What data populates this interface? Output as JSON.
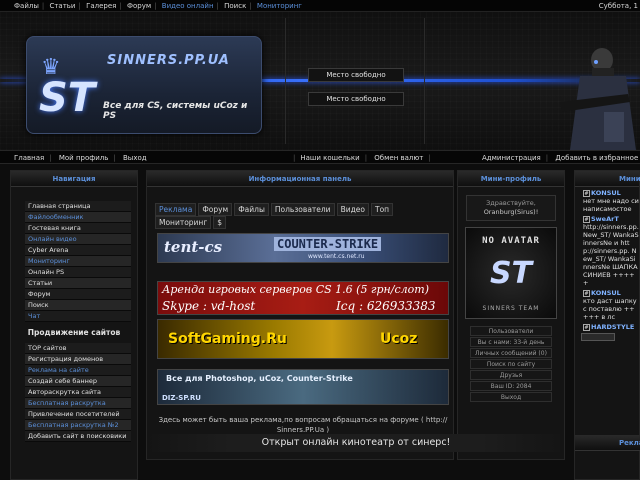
{
  "topnav": {
    "items": [
      "Файлы",
      "Статьи",
      "Галерея",
      "Форум",
      "Видео онлайн",
      "Поиск",
      "Мониторинг"
    ],
    "date": "Суббота, 1"
  },
  "header": {
    "site_name": "SINNERS.PP.UA",
    "logo_mark": "ST",
    "tagline": "Все для CS, системы uCoz и PS",
    "place1": "Место свободно",
    "place2": "Место свободно"
  },
  "subnav": {
    "left": [
      "Главная",
      "Мой профиль",
      "Выход"
    ],
    "middle": [
      "Наши кошельки",
      "Обмен валют"
    ],
    "right": [
      "Администрация",
      "Добавить в избранное"
    ]
  },
  "left": {
    "nav_title": "Навигация",
    "items": [
      {
        "label": "Главная страница",
        "blue": false
      },
      {
        "label": "Файлообменник",
        "blue": true
      },
      {
        "label": "Гостевая книга",
        "blue": false
      },
      {
        "label": "Онлайн видео",
        "blue": true
      },
      {
        "label": "Cyber Arena",
        "blue": false
      },
      {
        "label": "Мониторинг",
        "blue": true
      },
      {
        "label": "Онлайн PS",
        "blue": false
      },
      {
        "label": "Статьи",
        "blue": false
      },
      {
        "label": "Форум",
        "blue": false
      },
      {
        "label": "Поиск",
        "blue": false
      },
      {
        "label": "Чат",
        "blue": true
      }
    ],
    "promo_title": "Продвижение сайтов",
    "promo_items": [
      {
        "label": "TOP сайтов",
        "blue": false
      },
      {
        "label": "Регистрация доменов",
        "blue": false
      },
      {
        "label": "Реклама на сайте",
        "blue": true
      },
      {
        "label": "Создай себе баннер",
        "blue": false
      },
      {
        "label": "Автораскрутка сайта",
        "blue": false
      },
      {
        "label": "Бесплатная раскрутка",
        "blue": true
      },
      {
        "label": "Привлечение посетителей",
        "blue": false
      },
      {
        "label": "Бесплатная раскрутка №2",
        "blue": true
      },
      {
        "label": "Добавить сайт в поисковики",
        "blue": false
      }
    ]
  },
  "center": {
    "title": "Информационная панель",
    "tabs": [
      "Реклама",
      "Форум",
      "Файлы",
      "Пользователи",
      "Видео",
      "Топ",
      "Мониторинг",
      "$"
    ],
    "banner1_left": "tent-cs",
    "banner1_right": "COUNTER-STRIKE",
    "banner1_url": "www.tent.cs.net.ru",
    "banner2_line1": "Аренда игровых серверов CS 1.6 (5 грн/слот)",
    "banner2_skype": "Skype : vd-host",
    "banner2_icq": "Icq : 626933383",
    "banner3_left": "SoftGaming.Ru",
    "banner3_right": "Ucoz",
    "banner4_text": "Все для Photoshop, uCoz, Counter-Strike",
    "banner4_site": "DIZ-SP.RU",
    "info_text": "Здесь может быть ваша реклама,по вопросам обращаться на форуме ( http:// Sinners.PP.Ua )",
    "bottom_title": "Открыт онлайн кинотеатр от синерс!"
  },
  "profile": {
    "title": "Мини-профиль",
    "greeting": "Здравствуйте,",
    "username": "Oranburg(Sirus)!",
    "no_avatar": "NO AVATAR",
    "avatar_mark": "ST",
    "avatar_team": "SINNERS TEAM",
    "items": [
      "Пользователи",
      "Вы с нами: 33-й день",
      "Личных сообщений (0)",
      "Поиск по сайту",
      "Друзья",
      "Ваш ID: 2084",
      "Выход"
    ]
  },
  "right": {
    "title": "Мини",
    "posts": [
      {
        "nick": "KONSUL",
        "text": "нет мне надо си написамостое"
      },
      {
        "nick": "SweArT",
        "text": "http://sinners.pp. New_ST/ WankaSinnersNe и http://sinners.pp. New_ST/ WankaSinnersNe ШАПКА СИНИЕВ +++++"
      },
      {
        "nick": "KONSUL",
        "text": "кто даст шапку с поставлю +++++ в лс"
      },
      {
        "nick": "HARDSTYLE",
        "text": ""
      }
    ],
    "bottom_title": "Рекла"
  }
}
